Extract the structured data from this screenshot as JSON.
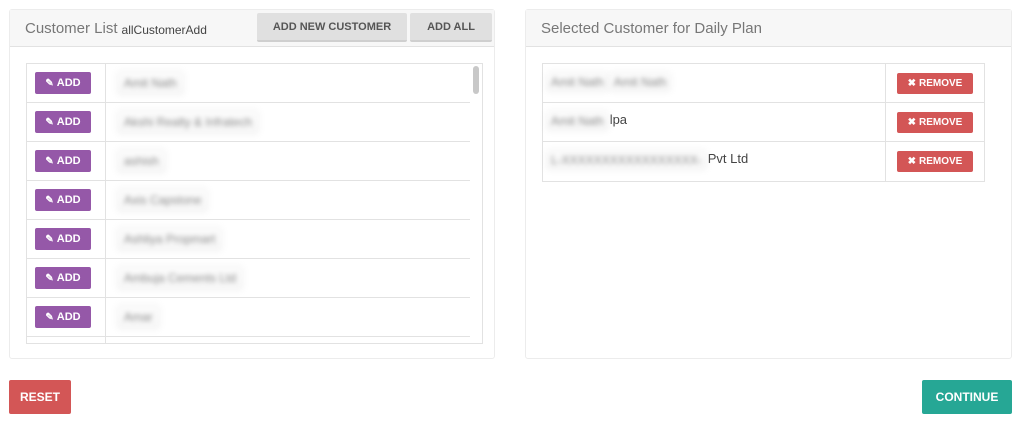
{
  "left_panel": {
    "title": "Customer List",
    "subtitle": "allCustomerAdd",
    "add_new_label": "ADD NEW CUSTOMER",
    "add_all_label": "ADD ALL",
    "add_button_label": "ADD",
    "add_icon": "edit-icon",
    "customers": [
      "Amit Nath",
      "Akshi Realty & Infratech",
      "ashish",
      "Axis Capstone",
      "Ashliya Propmart",
      "Ambuja Cements Ltd",
      "Amar",
      ""
    ]
  },
  "right_panel": {
    "title": "Selected Customer for Daily Plan",
    "remove_label": "REMOVE",
    "remove_icon": "close-icon",
    "selected": [
      {
        "blurred": "Amit Nath",
        "blurred2": "Amit Nath",
        "visible": ""
      },
      {
        "blurred": "Amit Nath",
        "blurred2": "",
        "visible": "lpa"
      },
      {
        "blurred": "L-XXXXXXXXXXXXXXXXX-",
        "blurred2": "",
        "visible": "Pvt Ltd"
      }
    ]
  },
  "footer": {
    "reset_label": "RESET",
    "continue_label": "CONTINUE"
  },
  "colors": {
    "add_button": "#9558a8",
    "remove_button": "#d35656",
    "continue_button": "#26a795"
  }
}
